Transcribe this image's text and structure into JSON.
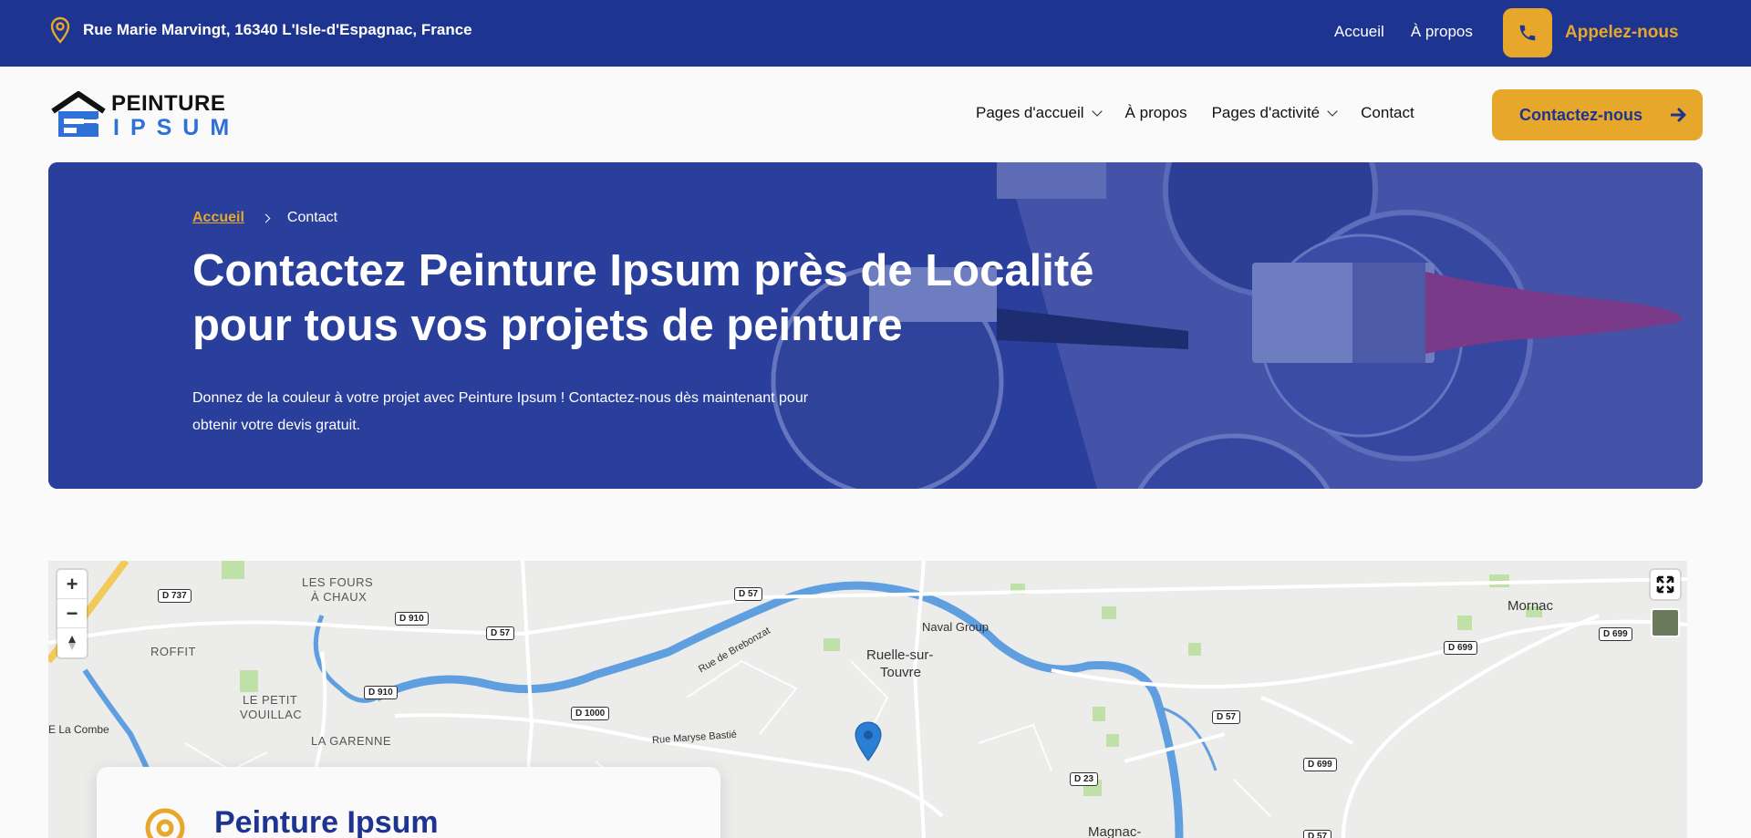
{
  "topbar": {
    "address": "Rue Marie Marvingt, 16340 L'Isle-d'Espagnac, France",
    "links": [
      "Accueil",
      "À propos"
    ],
    "call_label": "Appelez-nous"
  },
  "logo": {
    "line1": "PEINTURE",
    "line2": "IPSUM"
  },
  "nav": {
    "items": [
      "Pages d'accueil",
      "À propos",
      "Pages d'activité",
      "Contact"
    ],
    "cta_label": "Contactez-nous"
  },
  "hero": {
    "breadcrumb_home": "Accueil",
    "breadcrumb_current": "Contact",
    "title": "Contactez Peinture Ipsum près de Localité pour tous vos projets de peinture",
    "subtitle": "Donnez de la couleur à votre projet avec Peinture Ipsum ! Contactez-nous dès maintenant pour obtenir votre devis gratuit."
  },
  "map": {
    "labels": {
      "les_fours": "LES FOURS",
      "a_chaux": "À CHAUX",
      "roffit": "ROFFIT",
      "le_petit": "LE PETIT",
      "vouillac": "VOUILLAC",
      "la_garenne": "LA GARENNE",
      "la_combe": "E La Combe",
      "naval_group": "Naval Group",
      "ruelle1": "Ruelle-sur-",
      "ruelle2": "Touvre",
      "mornac": "Mornac",
      "magnac": "Magnac-",
      "rue_brebonzat": "Rue de Brebonzat",
      "rue_maryse": "Rue Maryse Bastié"
    },
    "roads": {
      "d737": "D 737",
      "d910a": "D 910",
      "d57a": "D 57",
      "d57b": "D 57",
      "d910b": "D 910",
      "d1000": "D 1000",
      "d699a": "D 699",
      "d699b": "D 699",
      "d57c": "D 57",
      "d23": "D 23",
      "d699c": "D 699",
      "d57d": "D 57"
    },
    "zoom_in": "+",
    "zoom_out": "−"
  },
  "card": {
    "title": "Peinture Ipsum"
  },
  "colors": {
    "primary": "#1d3490",
    "accent": "#e6a72a",
    "logo_blue": "#2e6fd8"
  }
}
